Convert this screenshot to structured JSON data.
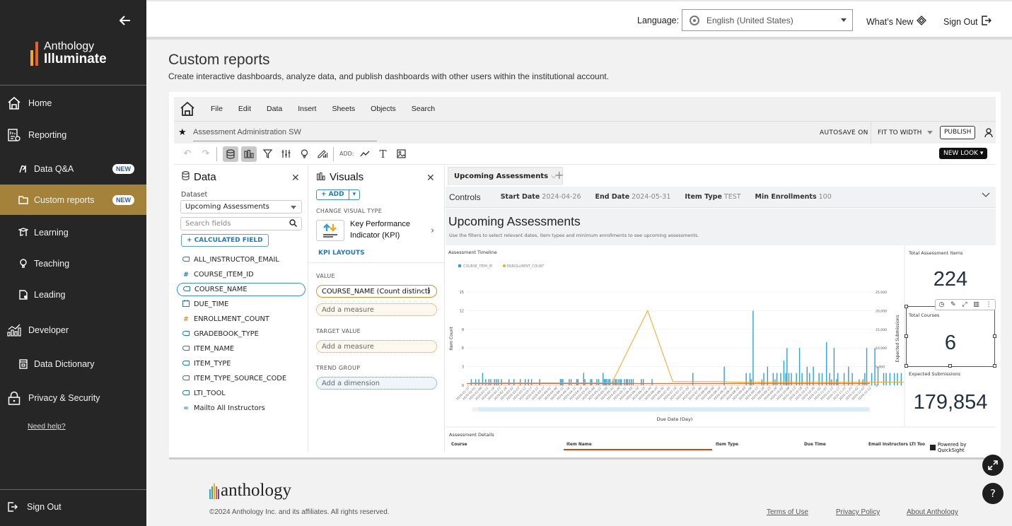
{
  "sidebar": {
    "brand_line1": "Anthology",
    "brand_line2": "Illuminate",
    "items": [
      {
        "label": "Home",
        "icon": "home-icon"
      },
      {
        "label": "Reporting",
        "icon": "reporting-icon"
      },
      {
        "label": "Data Q&A",
        "icon": "data-qa-icon",
        "badge": "NEW"
      },
      {
        "label": "Custom reports",
        "icon": "folder-icon",
        "badge": "NEW",
        "active": true
      },
      {
        "label": "Learning",
        "icon": "learning-icon"
      },
      {
        "label": "Teaching",
        "icon": "lightbulb-icon"
      },
      {
        "label": "Leading",
        "icon": "leading-icon"
      },
      {
        "label": "Developer",
        "icon": "developer-chart-icon"
      },
      {
        "label": "Data Dictionary",
        "icon": "dictionary-icon"
      },
      {
        "label": "Privacy & Security",
        "icon": "lock-icon"
      }
    ],
    "need_help": "Need help?",
    "sign_out": "Sign Out"
  },
  "topbar": {
    "language_label": "Language:",
    "language_value": "English (United States)",
    "whats_new": "What’s New",
    "sign_out": "Sign Out"
  },
  "page": {
    "title": "Custom reports",
    "subtitle": "Create interactive dashboards, analyze data, and publish dashboards with other users within the institutional account."
  },
  "quicksight": {
    "menu": [
      "File",
      "Edit",
      "Data",
      "Insert",
      "Sheets",
      "Objects",
      "Search"
    ],
    "analysis_name": "Assessment Administration SW",
    "autosave": "AUTOSAVE ON",
    "fit": "FIT TO WIDTH",
    "publish": "PUBLISH",
    "add_label": "ADD:",
    "new_look": "NEW LOOK",
    "data_panel": {
      "title": "Data",
      "dataset_label": "Dataset",
      "dataset_value": "Upcoming Assessments",
      "search_placeholder": "Search fields",
      "calc_field": "+ CALCULATED FIELD",
      "fields": [
        {
          "name": "ALL_INSTRUCTOR_EMAIL",
          "type": "dimension"
        },
        {
          "name": "COURSE_ITEM_ID",
          "type": "measure-id"
        },
        {
          "name": "COURSE_NAME",
          "type": "dimension",
          "selected": true
        },
        {
          "name": "DUE_TIME",
          "type": "date"
        },
        {
          "name": "ENROLLMENT_COUNT",
          "type": "measure"
        },
        {
          "name": "GRADEBOOK_TYPE",
          "type": "dimension"
        },
        {
          "name": "ITEM_NAME",
          "type": "dimension"
        },
        {
          "name": "ITEM_TYPE",
          "type": "dimension"
        },
        {
          "name": "ITEM_TYPE_SOURCE_CODE",
          "type": "dimension"
        },
        {
          "name": "LTI_TOOL",
          "type": "dimension"
        },
        {
          "name": "Mailto All Instructors",
          "type": "calculated"
        }
      ]
    },
    "visuals_panel": {
      "title": "Visuals",
      "add": "+ ADD",
      "change_type_label": "CHANGE VISUAL TYPE",
      "visual_type": "Key Performance Indicator (KPI)",
      "kpi_layouts": "KPI LAYOUTS",
      "value_label": "VALUE",
      "value_field": "COURSE_NAME (Count distinct)",
      "add_measure": "Add a measure",
      "target_label": "TARGET VALUE",
      "target_placeholder": "Add a measure",
      "trend_label": "TREND GROUP",
      "trend_placeholder": "Add a dimension"
    },
    "sheet": {
      "tab": "Upcoming Assessments",
      "controls_label": "Controls",
      "controls": [
        {
          "label": "Start Date",
          "value": "2024-04-26"
        },
        {
          "label": "End Date",
          "value": "2024-05-31"
        },
        {
          "label": "Item Type",
          "value": "TEST"
        },
        {
          "label": "Min Enrollments",
          "value": "100"
        }
      ],
      "title": "Upcoming Assessments",
      "description": "Use the filters to select relevant dates, item types and minimum enrollments to see upcoming assessments.",
      "kpis": [
        {
          "label": "Total Assessment Items",
          "value": "224"
        },
        {
          "label": "Total Courses",
          "value": "6"
        },
        {
          "label": "Expected Submissions",
          "value": "179,854"
        }
      ],
      "details": {
        "title": "Assessment Details",
        "columns": [
          "Course",
          "Item Name",
          "Item Type",
          "Due Time",
          "Email Instructors",
          "LTI Too"
        ]
      },
      "powered_by": "Powered by QuickSight"
    }
  },
  "chart_data": {
    "type": "bar",
    "title": "Assessment Timeline",
    "xlabel": "Due Date (Day)",
    "ylabel": "Item Count",
    "y2label": "Expected Submissions",
    "ylim": [
      0,
      15
    ],
    "y_ticks": [
      "0",
      "3",
      "6",
      "9",
      "12",
      "15"
    ],
    "y2lim": [
      0,
      25000
    ],
    "y2_ticks": [
      "0",
      "5,000",
      "10,000",
      "15,000",
      "20,000",
      "25,000"
    ],
    "legend": [
      {
        "name": "COURSE_ITEM_ID",
        "color": "#2ca0d9"
      },
      {
        "name": "ENROLLMENT_COUNT",
        "color": "#f5a623"
      }
    ],
    "legend_position": "top-left",
    "x_tick_labels": [
      "2020-01-27",
      "2020-02-01",
      "2020-02-06",
      "2020-02-11",
      "2020-02-16",
      "2020-02-21",
      "2020-02-26",
      "2020-03-02",
      "2020-03-07",
      "2020-03-12",
      "2020-03-17",
      "2020-03-22",
      "2020-03-27",
      "2020-04-01",
      "2020-04-06",
      "2020-04-11",
      "2020-04-16",
      "2020-04-21",
      "2020-04-26",
      "2020-05-01",
      "2020-05-06",
      "2020-05-11",
      "2020-05-16",
      "2020-05-21",
      "2020-05-26",
      "2020-05-31",
      "2020-06-05",
      "2020-06-10",
      "2020-06-15",
      "2020-06-20",
      "2020-06-25",
      "2020-06-30",
      "2020-07-05",
      "2020-07-10",
      "2020-07-15",
      "2020-07-20",
      "2020-07-25",
      "2020-07-30",
      "2020-08-04",
      "2020-08-09",
      "2020-08-14",
      "2020-08-19",
      "2020-08-24",
      "2020-08-29",
      "2020-09-03",
      "2020-09-08",
      "2020-09-13",
      "2020-09-18",
      "2020-09-23",
      "2020-09-28",
      "2020-10-03",
      "2020-10-08",
      "2020-10-13",
      "2020-10-18",
      "2020-10-23",
      "2020-10-28",
      "2020-11-02",
      "2020-11-07",
      "2020-11-12",
      "2020-11-17",
      "2020-11-22",
      "2020-11-27",
      "2020-12-02",
      "2020-12-07",
      "2020-12-12"
    ],
    "bars_item_count": [
      {
        "x": 0.5,
        "v": 1
      },
      {
        "x": 1.2,
        "v": 1
      },
      {
        "x": 1.7,
        "v": 1
      },
      {
        "x": 2.3,
        "v": 2
      },
      {
        "x": 2.8,
        "v": 1
      },
      {
        "x": 3.3,
        "v": 1
      },
      {
        "x": 3.6,
        "v": 1
      },
      {
        "x": 4.2,
        "v": 1
      },
      {
        "x": 4.5,
        "v": 1
      },
      {
        "x": 4.8,
        "v": 1
      },
      {
        "x": 5.3,
        "v": 1
      },
      {
        "x": 6.5,
        "v": 1
      },
      {
        "x": 7.3,
        "v": 1
      },
      {
        "x": 8.3,
        "v": 1
      },
      {
        "x": 9.1,
        "v": 1
      },
      {
        "x": 9.6,
        "v": 1
      },
      {
        "x": 10.1,
        "v": 1
      },
      {
        "x": 11.4,
        "v": 1
      },
      {
        "x": 14.7,
        "v": 1
      },
      {
        "x": 14.9,
        "v": 1
      },
      {
        "x": 15.1,
        "v": 1
      },
      {
        "x": 16.1,
        "v": 1
      },
      {
        "x": 16.4,
        "v": 1
      },
      {
        "x": 17.3,
        "v": 1
      },
      {
        "x": 17.5,
        "v": 1
      },
      {
        "x": 18.4,
        "v": 2
      },
      {
        "x": 18.6,
        "v": 1
      },
      {
        "x": 19.5,
        "v": 1
      },
      {
        "x": 19.7,
        "v": 1
      },
      {
        "x": 20.5,
        "v": 1
      },
      {
        "x": 20.8,
        "v": 1
      },
      {
        "x": 21.5,
        "v": 2
      },
      {
        "x": 21.7,
        "v": 1
      },
      {
        "x": 21.9,
        "v": 1
      },
      {
        "x": 22.1,
        "v": 1
      },
      {
        "x": 22.4,
        "v": 1
      },
      {
        "x": 22.6,
        "v": 1
      },
      {
        "x": 23.1,
        "v": 1
      },
      {
        "x": 23.4,
        "v": 1
      },
      {
        "x": 23.6,
        "v": 1
      },
      {
        "x": 23.9,
        "v": 1
      },
      {
        "x": 24.2,
        "v": 1
      },
      {
        "x": 24.4,
        "v": 1
      },
      {
        "x": 24.9,
        "v": 1
      },
      {
        "x": 25.2,
        "v": 1
      },
      {
        "x": 25.4,
        "v": 1
      },
      {
        "x": 25.7,
        "v": 1
      },
      {
        "x": 26.0,
        "v": 1
      },
      {
        "x": 26.3,
        "v": 1
      },
      {
        "x": 27.6,
        "v": 1
      },
      {
        "x": 27.9,
        "v": 1
      },
      {
        "x": 29.3,
        "v": 1
      },
      {
        "x": 35.8,
        "v": 2
      },
      {
        "x": 40.8,
        "v": 3
      },
      {
        "x": 58.7,
        "v": 1
      }
    ],
    "bars_expected_submissions": [
      {
        "x": 44.3,
        "v": 3300
      },
      {
        "x": 44.9,
        "v": 3300
      },
      {
        "x": 45.1,
        "v": 1600
      },
      {
        "x": 45.4,
        "v": 20000
      },
      {
        "x": 46.8,
        "v": 1600
      },
      {
        "x": 47.1,
        "v": 3300
      },
      {
        "x": 47.7,
        "v": 5000
      },
      {
        "x": 48.6,
        "v": 3300
      },
      {
        "x": 48.9,
        "v": 1600
      },
      {
        "x": 49.2,
        "v": 3300
      },
      {
        "x": 49.8,
        "v": 3300
      },
      {
        "x": 50.3,
        "v": 6600
      },
      {
        "x": 50.6,
        "v": 3300
      },
      {
        "x": 50.8,
        "v": 10000
      },
      {
        "x": 51.1,
        "v": 3300
      },
      {
        "x": 51.5,
        "v": 3300
      },
      {
        "x": 52.3,
        "v": 3300
      },
      {
        "x": 52.8,
        "v": 10000
      },
      {
        "x": 53.2,
        "v": 3300
      },
      {
        "x": 54.0,
        "v": 5000
      },
      {
        "x": 54.4,
        "v": 3300
      },
      {
        "x": 55.0,
        "v": 5000
      },
      {
        "x": 55.9,
        "v": 3300
      },
      {
        "x": 56.4,
        "v": 3300
      },
      {
        "x": 57.1,
        "v": 11600
      },
      {
        "x": 57.6,
        "v": 3300
      },
      {
        "x": 57.9,
        "v": 1600
      },
      {
        "x": 58.3,
        "v": 10000
      },
      {
        "x": 58.9,
        "v": 3300
      },
      {
        "x": 59.9,
        "v": 3300
      },
      {
        "x": 60.6,
        "v": 5000
      },
      {
        "x": 61.2,
        "v": 3300
      },
      {
        "x": 62.3,
        "v": 1600
      },
      {
        "x": 62.9,
        "v": 1600
      },
      {
        "x": 63.2,
        "v": 3300
      },
      {
        "x": 63.5,
        "v": 10000
      },
      {
        "x": 64.3,
        "v": 3300
      },
      {
        "x": 64.8,
        "v": 10000
      },
      {
        "x": 65.3,
        "v": 5000
      },
      {
        "x": 66.2,
        "v": 3300
      },
      {
        "x": 66.6,
        "v": 3300
      },
      {
        "x": 67.2,
        "v": 3300
      },
      {
        "x": 67.9,
        "v": 3300
      },
      {
        "x": 68.4,
        "v": 3300
      },
      {
        "x": 69.0,
        "v": 3300
      },
      {
        "x": 70.1,
        "v": 3300
      },
      {
        "x": 70.6,
        "v": 10000
      },
      {
        "x": 71.0,
        "v": 11600
      },
      {
        "x": 72.0,
        "v": 3300
      },
      {
        "x": 72.3,
        "v": 1600
      },
      {
        "x": 73.9,
        "v": 6600
      },
      {
        "x": 74.2,
        "v": 11600
      }
    ],
    "line_enrollment_count": [
      [
        0.3,
        0.4
      ],
      [
        22.9,
        0.4
      ],
      [
        28.6,
        12
      ],
      [
        32.6,
        0.6
      ],
      [
        39.5,
        0.6
      ],
      [
        43.5,
        0.5
      ],
      [
        74.3,
        0.5
      ]
    ],
    "reference_line": 0.3
  }
}
